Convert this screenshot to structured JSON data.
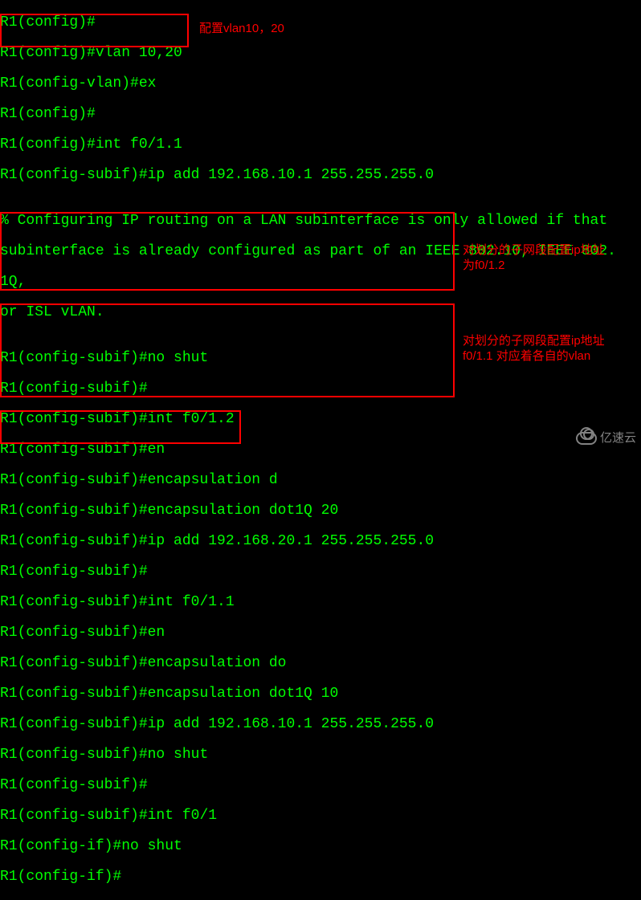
{
  "terminal": {
    "lines": [
      "R1(config)#",
      "R1(config)#vlan 10,20",
      "R1(config-vlan)#ex",
      "R1(config)#",
      "R1(config)#int f0/1.1",
      "R1(config-subif)#ip add 192.168.10.1 255.255.255.0",
      "",
      "% Configuring IP routing on a LAN subinterface is only allowed if that",
      "subinterface is already configured as part of an IEEE 802.10, IEEE 802.",
      "1Q,",
      "or ISL vLAN.",
      "",
      "R1(config-subif)#no shut",
      "R1(config-subif)#",
      "R1(config-subif)#int f0/1.2",
      "R1(config-subif)#en",
      "R1(config-subif)#encapsulation d",
      "R1(config-subif)#encapsulation dot1Q 20",
      "R1(config-subif)#ip add 192.168.20.1 255.255.255.0",
      "R1(config-subif)#",
      "R1(config-subif)#int f0/1.1",
      "R1(config-subif)#en",
      "R1(config-subif)#encapsulation do",
      "R1(config-subif)#encapsulation dot1Q 10",
      "R1(config-subif)#ip add 192.168.10.1 255.255.255.0",
      "R1(config-subif)#no shut",
      "R1(config-subif)#",
      "R1(config-subif)#int f0/1",
      "R1(config-if)#no shut",
      "R1(config-if)#"
    ]
  },
  "annotations": {
    "a1": "配置vlan10，20",
    "a2l1": "对划分的子网段配置ip地址",
    "a2l2": "为f0/1.2",
    "a3l1": "对划分的子网段配置ip地址",
    "a3l2": "f0/1.1  对应着各自的vlan"
  },
  "watermark": {
    "text": "亿速云"
  }
}
